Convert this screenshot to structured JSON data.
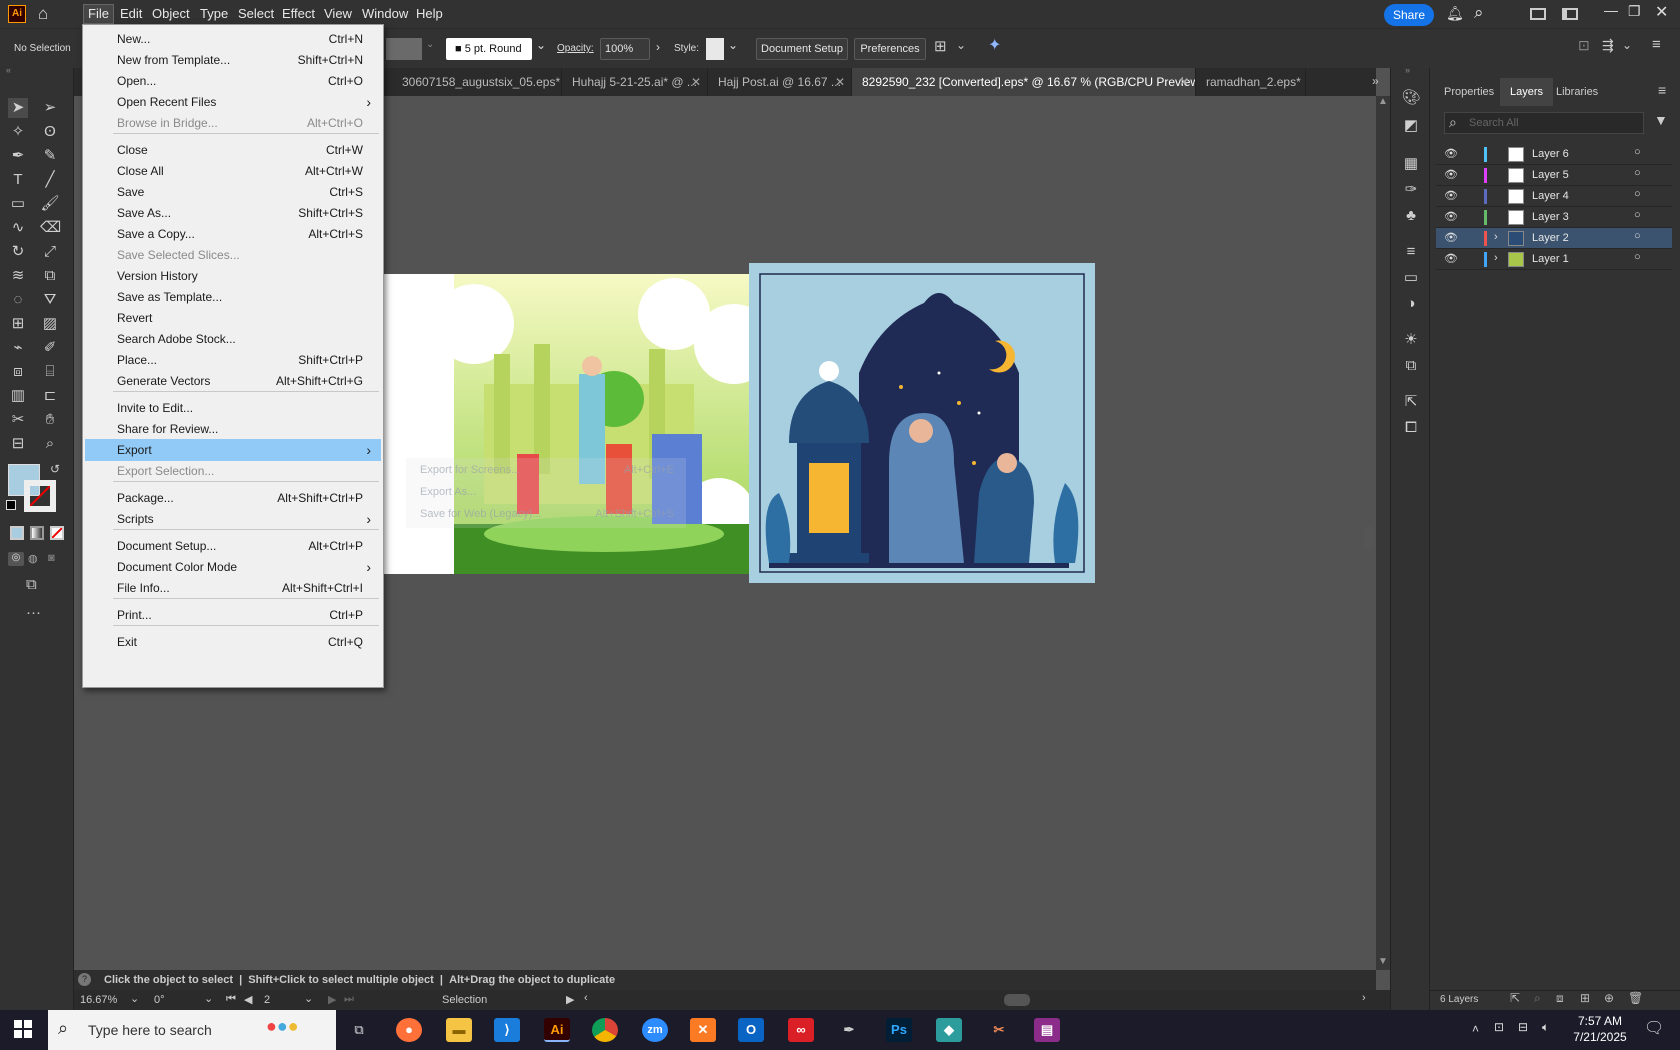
{
  "app": {
    "logo": "Ai"
  },
  "menubar": [
    "File",
    "Edit",
    "Object",
    "Type",
    "Select",
    "Effect",
    "View",
    "Window",
    "Help"
  ],
  "share_label": "Share",
  "control": {
    "selection": "No Selection",
    "stroke_profile": "5 pt. Round",
    "opacity_label": "Opacity:",
    "opacity_value": "100%",
    "style_label": "Style:",
    "document_setup": "Document Setup",
    "preferences": "Preferences"
  },
  "tabs": [
    {
      "label": "30607158_augustsix_05.eps*"
    },
    {
      "label": "Huhajj 5-21-25.ai* @ ..."
    },
    {
      "label": "Hajj Post.ai @ 16.67 ..."
    },
    {
      "label": "8292590_232 [Converted].eps* @ 16.67 % (RGB/CPU Preview)"
    },
    {
      "label": "ramadhan_2.eps* @"
    }
  ],
  "file_menu": [
    {
      "label": "New...",
      "shortcut": "Ctrl+N",
      "disabled": false,
      "submenu": false
    },
    {
      "label": "New from Template...",
      "shortcut": "Shift+Ctrl+N",
      "disabled": false,
      "submenu": false
    },
    {
      "label": "Open...",
      "shortcut": "Ctrl+O",
      "disabled": false,
      "submenu": false
    },
    {
      "label": "Open Recent Files",
      "shortcut": "",
      "disabled": false,
      "submenu": true
    },
    {
      "label": "Browse in Bridge...",
      "shortcut": "Alt+Ctrl+O",
      "disabled": true,
      "submenu": false
    },
    {
      "label": "Close",
      "shortcut": "Ctrl+W",
      "disabled": false,
      "submenu": false
    },
    {
      "label": "Close All",
      "shortcut": "Alt+Ctrl+W",
      "disabled": false,
      "submenu": false
    },
    {
      "label": "Save",
      "shortcut": "Ctrl+S",
      "disabled": false,
      "submenu": false
    },
    {
      "label": "Save As...",
      "shortcut": "Shift+Ctrl+S",
      "disabled": false,
      "submenu": false
    },
    {
      "label": "Save a Copy...",
      "shortcut": "Alt+Ctrl+S",
      "disabled": false,
      "submenu": false
    },
    {
      "label": "Save Selected Slices...",
      "shortcut": "",
      "disabled": true,
      "submenu": false
    },
    {
      "label": "Version History",
      "shortcut": "",
      "disabled": false,
      "submenu": false
    },
    {
      "label": "Save as Template...",
      "shortcut": "",
      "disabled": false,
      "submenu": false
    },
    {
      "label": "Revert",
      "shortcut": "",
      "disabled": false,
      "submenu": false
    },
    {
      "label": "Search Adobe Stock...",
      "shortcut": "",
      "disabled": false,
      "submenu": false
    },
    {
      "label": "Place...",
      "shortcut": "Shift+Ctrl+P",
      "disabled": false,
      "submenu": false
    },
    {
      "label": "Generate Vectors",
      "shortcut": "Alt+Shift+Ctrl+G",
      "disabled": false,
      "submenu": false
    },
    {
      "label": "Invite to Edit...",
      "shortcut": "",
      "disabled": false,
      "submenu": false
    },
    {
      "label": "Share for Review...",
      "shortcut": "",
      "disabled": false,
      "submenu": false
    },
    {
      "label": "Export",
      "shortcut": "",
      "disabled": false,
      "submenu": true,
      "highlighted": true
    },
    {
      "label": "Export Selection...",
      "shortcut": "",
      "disabled": true,
      "submenu": false
    },
    {
      "label": "Package...",
      "shortcut": "Alt+Shift+Ctrl+P",
      "disabled": false,
      "submenu": false
    },
    {
      "label": "Scripts",
      "shortcut": "",
      "disabled": false,
      "submenu": true
    },
    {
      "label": "Document Setup...",
      "shortcut": "Alt+Ctrl+P",
      "disabled": false,
      "submenu": false
    },
    {
      "label": "Document Color Mode",
      "shortcut": "",
      "disabled": false,
      "submenu": true
    },
    {
      "label": "File Info...",
      "shortcut": "Alt+Shift+Ctrl+I",
      "disabled": false,
      "submenu": false
    },
    {
      "label": "Print...",
      "shortcut": "Ctrl+P",
      "disabled": false,
      "submenu": false
    },
    {
      "label": "Exit",
      "shortcut": "Ctrl+Q",
      "disabled": false,
      "submenu": false
    }
  ],
  "export_submenu": [
    {
      "label": "Export for Screens...",
      "shortcut": "Alt+Ctrl+E"
    },
    {
      "label": "Export As...",
      "shortcut": ""
    },
    {
      "label": "Save for Web (Legacy)...",
      "shortcut": "Alt+Shift+Ctrl+S"
    }
  ],
  "panel_tabs": [
    "Properties",
    "Layers",
    "Libraries"
  ],
  "layers_search_placeholder": "Search All",
  "layers": [
    {
      "name": "Layer 6",
      "color": "#4fc3f7",
      "expandable": false,
      "selected": false
    },
    {
      "name": "Layer 5",
      "color": "#e040fb",
      "expandable": false,
      "selected": false
    },
    {
      "name": "Layer 4",
      "color": "#5c6bc0",
      "expandable": false,
      "selected": false
    },
    {
      "name": "Layer 3",
      "color": "#66bb6a",
      "expandable": false,
      "selected": false
    },
    {
      "name": "Layer 2",
      "color": "#ef5350",
      "expandable": true,
      "selected": true
    },
    {
      "name": "Layer 1",
      "color": "#42a5f5",
      "expandable": true,
      "selected": false
    }
  ],
  "layers_count": "6 Layers",
  "status_hint": {
    "a": "Click the object to select",
    "b": "Shift+Click to select multiple object",
    "c": "Alt+Drag the object to duplicate"
  },
  "bottom": {
    "zoom": "16.67%",
    "rotation": "0°",
    "artboard": "2",
    "tool": "Selection"
  },
  "taskbar": {
    "search_placeholder": "Type here to search",
    "time": "7:57 AM",
    "date": "7/21/2025"
  }
}
